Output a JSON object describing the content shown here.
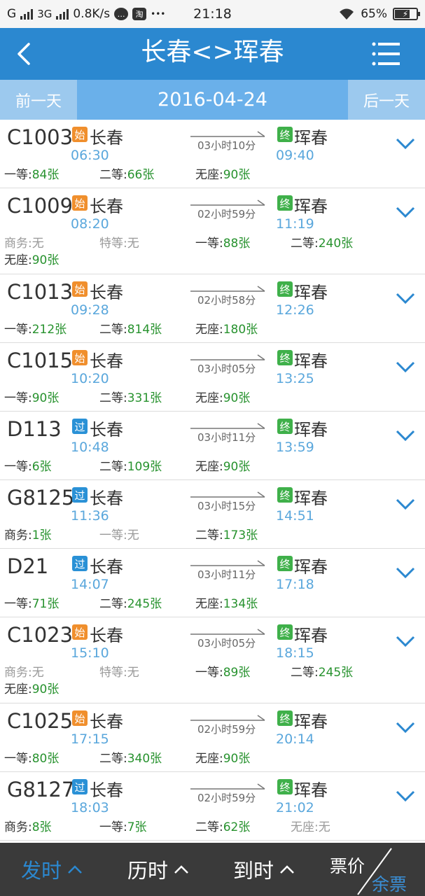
{
  "status": {
    "signal1": "G",
    "signal2": "3G",
    "speed": "0.8K/s",
    "chat_icon": "chat-bubble-icon",
    "app_icon_label": "淘",
    "dots": "•••",
    "time": "21:18",
    "battery": "65%",
    "battery_level": 0.65
  },
  "header": {
    "title": "长春<>珲春",
    "back_icon": "back-chevron-icon",
    "menu_icon": "menu-list-icon"
  },
  "datebar": {
    "prev_label": "前一天",
    "date": "2016-04-24",
    "next_label": "后一天"
  },
  "trains": [
    {
      "no": "C1003",
      "badge": "始",
      "badge_type": "start",
      "from": "长春",
      "dep": "06:30",
      "dur": "03小时10分",
      "end_badge": "终",
      "to": "珲春",
      "arr": "09:40",
      "seats": [
        {
          "label": "一等:",
          "value": "84张"
        },
        {
          "label": "二等:",
          "value": "66张"
        },
        {
          "label": "无座:",
          "value": "90张"
        }
      ]
    },
    {
      "no": "C1009",
      "badge": "始",
      "badge_type": "start",
      "from": "长春",
      "dep": "08:20",
      "dur": "02小时59分",
      "end_badge": "终",
      "to": "珲春",
      "arr": "11:19",
      "seats": [
        {
          "label": "商务:",
          "value": "无"
        },
        {
          "label": "特等:",
          "value": "无"
        },
        {
          "label": "一等:",
          "value": "88张"
        },
        {
          "label": "二等:",
          "value": "240张"
        },
        {
          "label": "无座:",
          "value": "90张"
        }
      ]
    },
    {
      "no": "C1013",
      "badge": "始",
      "badge_type": "start",
      "from": "长春",
      "dep": "09:28",
      "dur": "02小时58分",
      "end_badge": "终",
      "to": "珲春",
      "arr": "12:26",
      "seats": [
        {
          "label": "一等:",
          "value": "212张"
        },
        {
          "label": "二等:",
          "value": "814张"
        },
        {
          "label": "无座:",
          "value": "180张"
        }
      ]
    },
    {
      "no": "C1015",
      "badge": "始",
      "badge_type": "start",
      "from": "长春",
      "dep": "10:20",
      "dur": "03小时05分",
      "end_badge": "终",
      "to": "珲春",
      "arr": "13:25",
      "seats": [
        {
          "label": "一等:",
          "value": "90张"
        },
        {
          "label": "二等:",
          "value": "331张"
        },
        {
          "label": "无座:",
          "value": "90张"
        }
      ]
    },
    {
      "no": "D113",
      "badge": "过",
      "badge_type": "pass",
      "from": "长春",
      "dep": "10:48",
      "dur": "03小时11分",
      "end_badge": "终",
      "to": "珲春",
      "arr": "13:59",
      "seats": [
        {
          "label": "一等:",
          "value": "6张"
        },
        {
          "label": "二等:",
          "value": "109张"
        },
        {
          "label": "无座:",
          "value": "90张"
        }
      ]
    },
    {
      "no": "G8125",
      "badge": "过",
      "badge_type": "pass",
      "from": "长春",
      "dep": "11:36",
      "dur": "03小时15分",
      "end_badge": "终",
      "to": "珲春",
      "arr": "14:51",
      "seats": [
        {
          "label": "商务:",
          "value": "1张"
        },
        {
          "label": "一等:",
          "value": "无"
        },
        {
          "label": "二等:",
          "value": "173张"
        }
      ]
    },
    {
      "no": "D21",
      "badge": "过",
      "badge_type": "pass",
      "from": "长春",
      "dep": "14:07",
      "dur": "03小时11分",
      "end_badge": "终",
      "to": "珲春",
      "arr": "17:18",
      "seats": [
        {
          "label": "一等:",
          "value": "71张"
        },
        {
          "label": "二等:",
          "value": "245张"
        },
        {
          "label": "无座:",
          "value": "134张"
        }
      ]
    },
    {
      "no": "C1023",
      "badge": "始",
      "badge_type": "start",
      "from": "长春",
      "dep": "15:10",
      "dur": "03小时05分",
      "end_badge": "终",
      "to": "珲春",
      "arr": "18:15",
      "seats": [
        {
          "label": "商务:",
          "value": "无"
        },
        {
          "label": "特等:",
          "value": "无"
        },
        {
          "label": "一等:",
          "value": "89张"
        },
        {
          "label": "二等:",
          "value": "245张"
        },
        {
          "label": "无座:",
          "value": "90张"
        }
      ]
    },
    {
      "no": "C1025",
      "badge": "始",
      "badge_type": "start",
      "from": "长春",
      "dep": "17:15",
      "dur": "02小时59分",
      "end_badge": "终",
      "to": "珲春",
      "arr": "20:14",
      "seats": [
        {
          "label": "一等:",
          "value": "80张"
        },
        {
          "label": "二等:",
          "value": "340张"
        },
        {
          "label": "无座:",
          "value": "90张"
        }
      ]
    },
    {
      "no": "G8127",
      "badge": "过",
      "badge_type": "pass",
      "from": "长春",
      "dep": "18:03",
      "dur": "02小时59分",
      "end_badge": "终",
      "to": "珲春",
      "arr": "21:02",
      "seats": [
        {
          "label": "商务:",
          "value": "8张"
        },
        {
          "label": "一等:",
          "value": "7张"
        },
        {
          "label": "二等:",
          "value": "62张"
        },
        {
          "label": "无座:",
          "value": "无"
        }
      ]
    }
  ],
  "bottom": {
    "sort_depart": "发时",
    "sort_duration": "历时",
    "sort_arrive": "到时",
    "price": "票价",
    "remaining": "余票",
    "active_color": "#2b88d0"
  }
}
